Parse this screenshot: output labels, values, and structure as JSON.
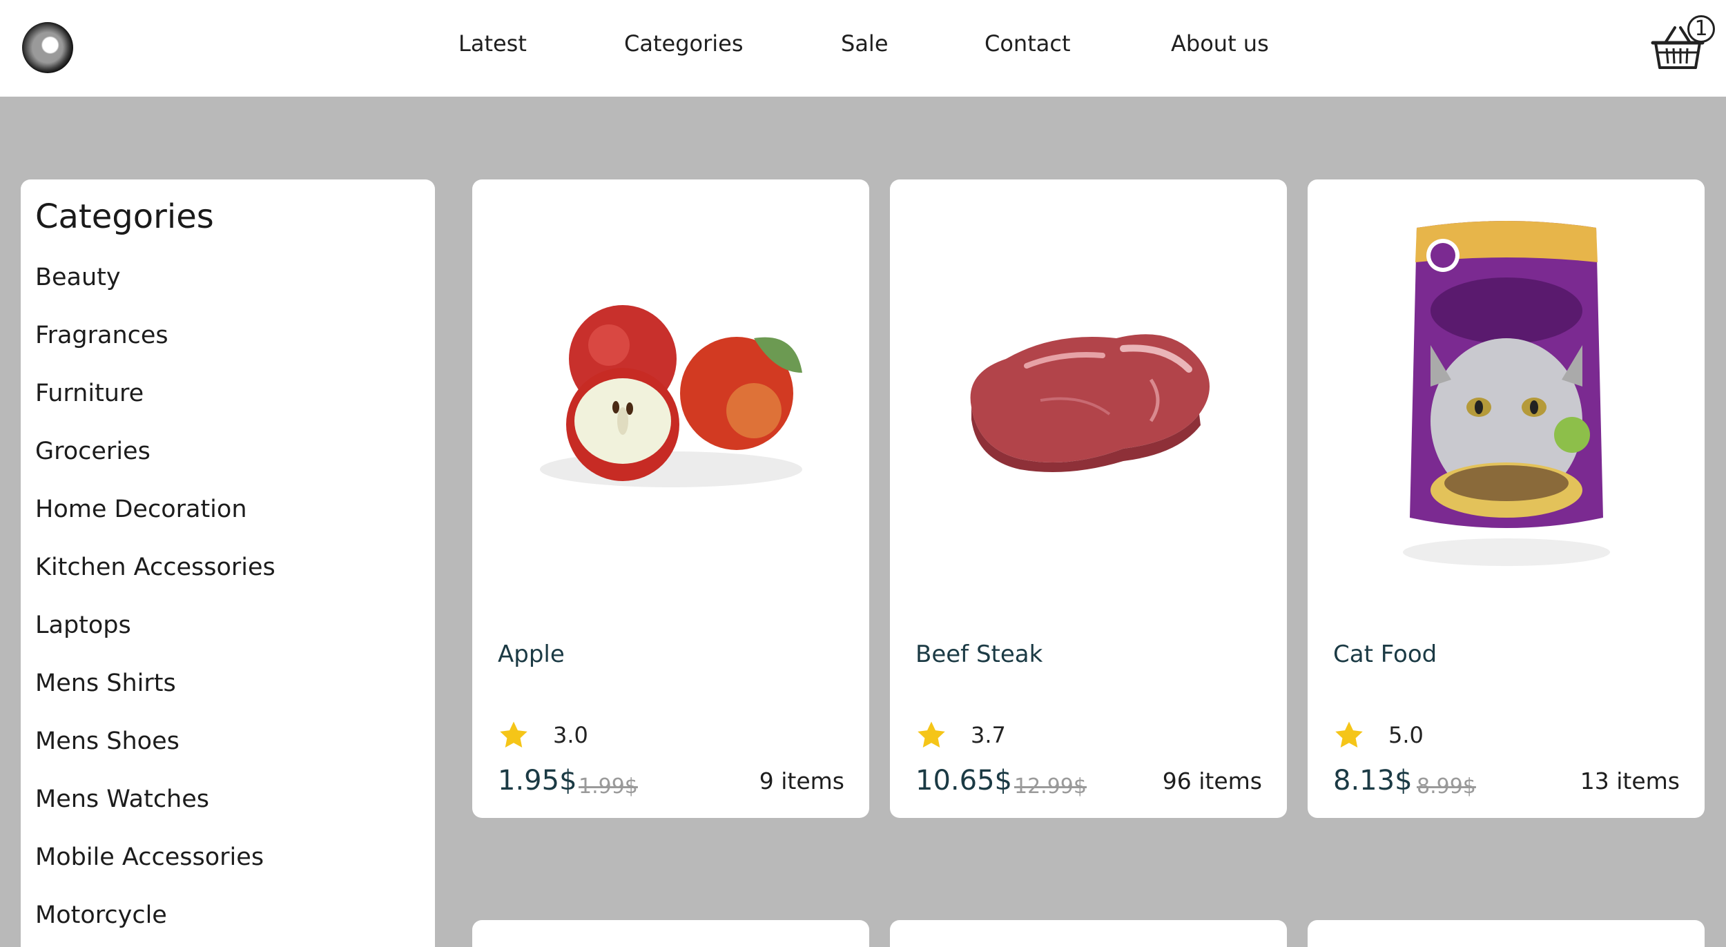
{
  "header": {
    "nav": [
      "Latest",
      "Categories",
      "Sale",
      "Contact",
      "About us"
    ],
    "cart_count": "1"
  },
  "sidebar": {
    "title": "Categories",
    "items": [
      "Beauty",
      "Fragrances",
      "Furniture",
      "Groceries",
      "Home Decoration",
      "Kitchen Accessories",
      "Laptops",
      "Mens Shirts",
      "Mens Shoes",
      "Mens Watches",
      "Mobile Accessories",
      "Motorcycle"
    ]
  },
  "products": [
    {
      "name": "Apple",
      "rating": "3.0",
      "price": "1.95$",
      "old_price": "1.99$",
      "stock": "9 items",
      "image": "apple-image"
    },
    {
      "name": "Beef Steak",
      "rating": "3.7",
      "price": "10.65$",
      "old_price": "12.99$",
      "stock": "96 items",
      "image": "beef-steak-image"
    },
    {
      "name": "Cat Food",
      "rating": "5.0",
      "price": "8.13$",
      "old_price": "8.99$",
      "stock": "13 items",
      "image": "cat-food-image"
    }
  ],
  "colors": {
    "background": "#b9b9b9",
    "card": "#ffffff",
    "accent_text": "#1b3a44",
    "star": "#f5c518",
    "old_price": "#9a9a9a"
  },
  "icons": [
    "logo",
    "basket-icon",
    "star-icon"
  ]
}
